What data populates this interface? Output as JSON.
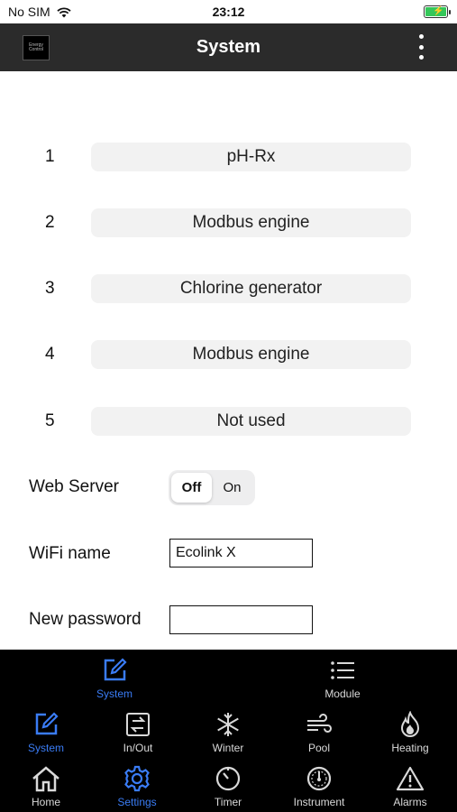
{
  "status_bar": {
    "carrier": "No SIM",
    "time": "23:12"
  },
  "header": {
    "logo_text": "Energy Control",
    "title": "System"
  },
  "modules": [
    {
      "number": "1",
      "value": "pH-Rx"
    },
    {
      "number": "2",
      "value": "Modbus engine"
    },
    {
      "number": "3",
      "value": "Chlorine generator"
    },
    {
      "number": "4",
      "value": "Modbus engine"
    },
    {
      "number": "5",
      "value": "Not used"
    }
  ],
  "web_server": {
    "label": "Web Server",
    "off": "Off",
    "on": "On",
    "selected": "Off"
  },
  "wifi": {
    "label": "WiFi name",
    "value": "Ecolink X"
  },
  "password": {
    "label": "New password",
    "value": ""
  },
  "subtabs": [
    {
      "label": "System",
      "icon": "edit-icon",
      "active": true
    },
    {
      "label": "Module",
      "icon": "list-icon",
      "active": false
    }
  ],
  "category_tabs": [
    {
      "label": "System",
      "icon": "edit-icon",
      "active": true
    },
    {
      "label": "In/Out",
      "icon": "swap-icon",
      "active": false
    },
    {
      "label": "Winter",
      "icon": "snowflake-icon",
      "active": false
    },
    {
      "label": "Pool",
      "icon": "wind-icon",
      "active": false
    },
    {
      "label": "Heating",
      "icon": "flame-icon",
      "active": false
    }
  ],
  "main_tabs": [
    {
      "label": "Home",
      "icon": "home-icon",
      "active": false
    },
    {
      "label": "Settings",
      "icon": "gear-icon",
      "active": true
    },
    {
      "label": "Timer",
      "icon": "timer-icon",
      "active": false
    },
    {
      "label": "Instrument",
      "icon": "gauge-icon",
      "active": false
    },
    {
      "label": "Alarms",
      "icon": "warning-icon",
      "active": false
    }
  ],
  "colors": {
    "accent": "#3a7cf5",
    "header": "#2b2b2b",
    "nav_background": "#000000"
  }
}
